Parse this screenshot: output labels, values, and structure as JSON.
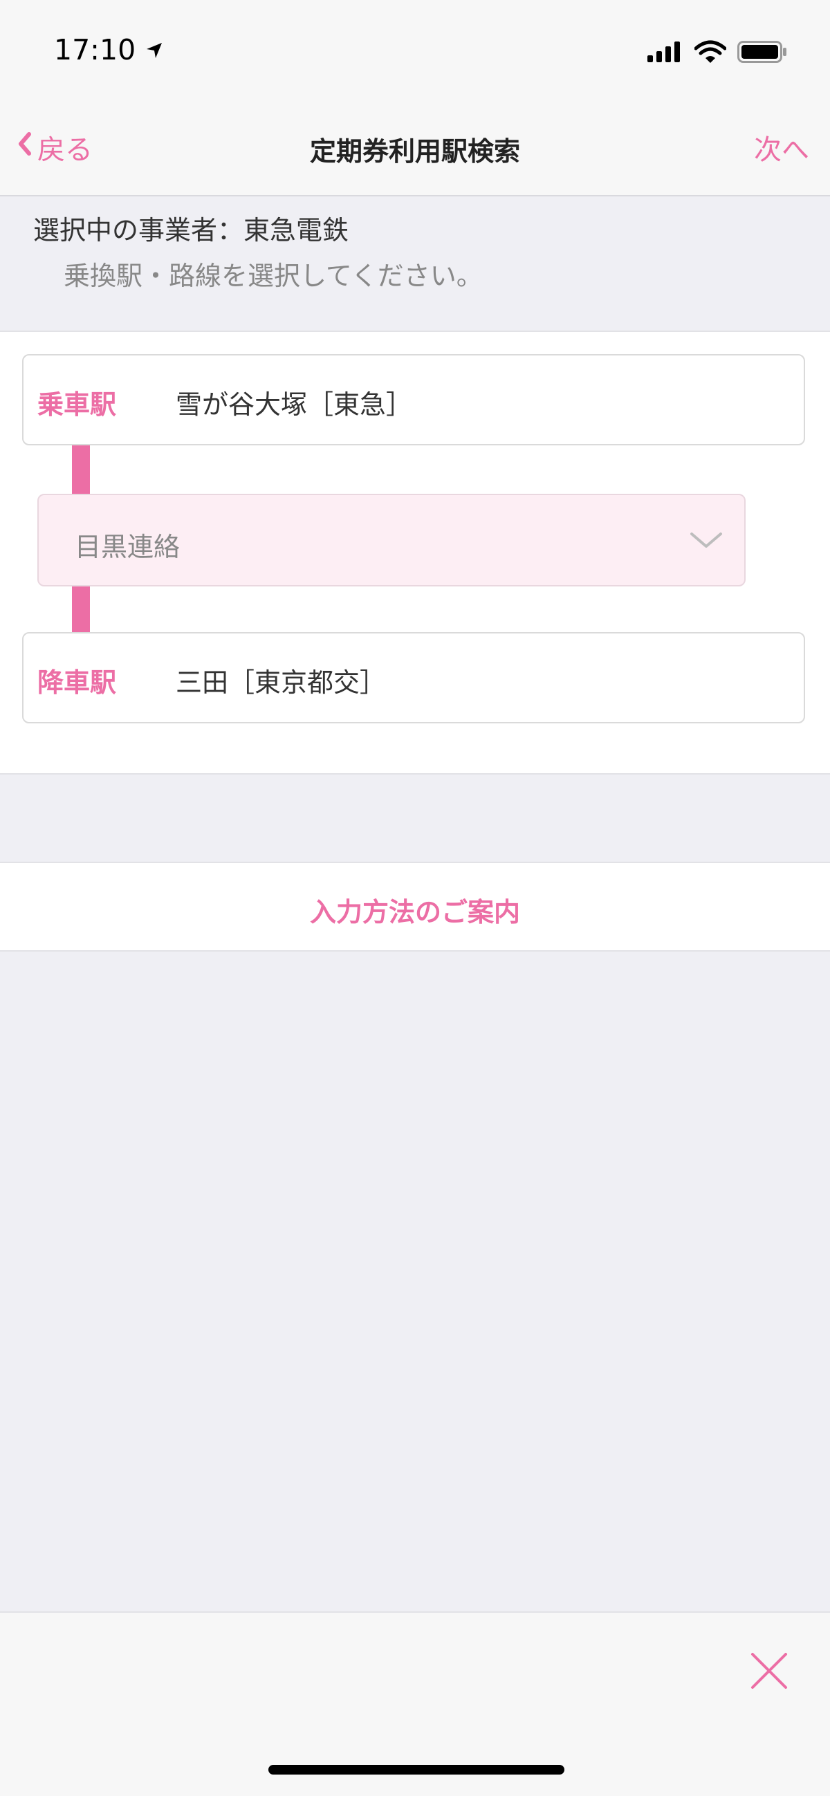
{
  "status_bar": {
    "time": "17:10",
    "icons": [
      "location-arrow-icon",
      "signal-icon",
      "wifi-icon",
      "battery-icon"
    ]
  },
  "nav": {
    "back_label": "戻る",
    "title": "定期券利用駅検索",
    "next_label": "次へ"
  },
  "info": {
    "operator_text": "選択中の事業者：東急電鉄",
    "hint_text": "乗換駅・路線を選択してください。"
  },
  "route": {
    "board": {
      "label": "乗車駅",
      "value": "雪が谷大塚［東急］"
    },
    "transfer_line": {
      "value": "目黒連絡"
    },
    "alight": {
      "label": "降車駅",
      "value": "三田［東京都交］"
    }
  },
  "guide": {
    "label": "入力方法のご案内"
  },
  "colors": {
    "accent": "#ec6ea5",
    "select_bg": "#fdeef4",
    "background": "#efeff4"
  }
}
